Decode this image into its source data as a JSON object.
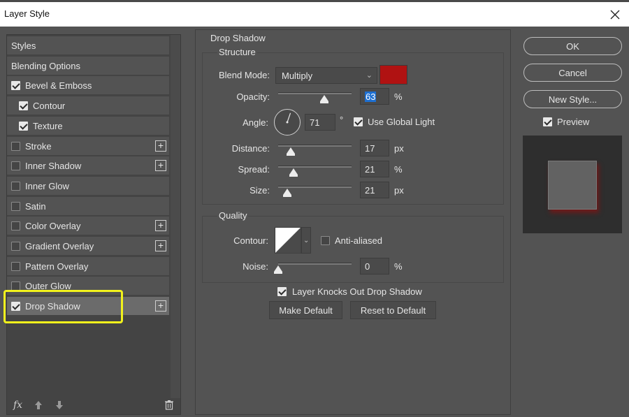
{
  "window": {
    "title": "Layer Style",
    "close_icon": "close-icon"
  },
  "styles_panel": {
    "items": [
      {
        "label": "Styles",
        "checkbox": false,
        "checked": false,
        "plus": false,
        "indent": false,
        "selected": false
      },
      {
        "label": "Blending Options",
        "checkbox": false,
        "checked": false,
        "plus": false,
        "indent": false,
        "selected": false
      },
      {
        "label": "Bevel & Emboss",
        "checkbox": true,
        "checked": true,
        "plus": false,
        "indent": false,
        "selected": false
      },
      {
        "label": "Contour",
        "checkbox": true,
        "checked": true,
        "plus": false,
        "indent": true,
        "selected": false
      },
      {
        "label": "Texture",
        "checkbox": true,
        "checked": true,
        "plus": false,
        "indent": true,
        "selected": false
      },
      {
        "label": "Stroke",
        "checkbox": true,
        "checked": false,
        "plus": true,
        "indent": false,
        "selected": false
      },
      {
        "label": "Inner Shadow",
        "checkbox": true,
        "checked": false,
        "plus": true,
        "indent": false,
        "selected": false
      },
      {
        "label": "Inner Glow",
        "checkbox": true,
        "checked": false,
        "plus": false,
        "indent": false,
        "selected": false
      },
      {
        "label": "Satin",
        "checkbox": true,
        "checked": false,
        "plus": false,
        "indent": false,
        "selected": false
      },
      {
        "label": "Color Overlay",
        "checkbox": true,
        "checked": false,
        "plus": true,
        "indent": false,
        "selected": false
      },
      {
        "label": "Gradient Overlay",
        "checkbox": true,
        "checked": false,
        "plus": true,
        "indent": false,
        "selected": false
      },
      {
        "label": "Pattern Overlay",
        "checkbox": true,
        "checked": false,
        "plus": false,
        "indent": false,
        "selected": false
      },
      {
        "label": "Outer Glow",
        "checkbox": true,
        "checked": false,
        "plus": false,
        "indent": false,
        "selected": false
      },
      {
        "label": "Drop Shadow",
        "checkbox": true,
        "checked": true,
        "plus": true,
        "indent": false,
        "selected": true
      }
    ],
    "footer": {
      "fx_label": "fx",
      "icons": [
        "fx-icon",
        "arrow-up-icon",
        "arrow-down-icon",
        "trash-icon"
      ]
    },
    "highlight_color": "#f2f21c"
  },
  "drop_shadow": {
    "section_title": "Drop Shadow",
    "structure": {
      "title": "Structure",
      "blend_mode": {
        "label": "Blend Mode:",
        "value": "Multiply",
        "color": "#b01212"
      },
      "opacity": {
        "label": "Opacity:",
        "value": "63",
        "unit": "%",
        "level": 0.63
      },
      "angle": {
        "label": "Angle:",
        "value": "71",
        "unit": "°",
        "degrees": 71
      },
      "use_global_light": {
        "label": "Use Global Light",
        "checked": true
      },
      "distance": {
        "label": "Distance:",
        "value": "17",
        "unit": "px",
        "level": 0.17
      },
      "spread": {
        "label": "Spread:",
        "value": "21",
        "unit": "%",
        "level": 0.21
      },
      "size": {
        "label": "Size:",
        "value": "21",
        "unit": "px",
        "level": 0.12
      }
    },
    "quality": {
      "title": "Quality",
      "contour": {
        "label": "Contour:"
      },
      "anti_aliased": {
        "label": "Anti-aliased",
        "checked": false
      },
      "noise": {
        "label": "Noise:",
        "value": "0",
        "unit": "%",
        "level": 0
      }
    },
    "knocks_out": {
      "label": "Layer Knocks Out Drop Shadow",
      "checked": true
    },
    "make_default": "Make Default",
    "reset_default": "Reset to Default"
  },
  "actions": {
    "ok": "OK",
    "cancel": "Cancel",
    "new_style": "New Style...",
    "preview": {
      "label": "Preview",
      "checked": true
    }
  }
}
